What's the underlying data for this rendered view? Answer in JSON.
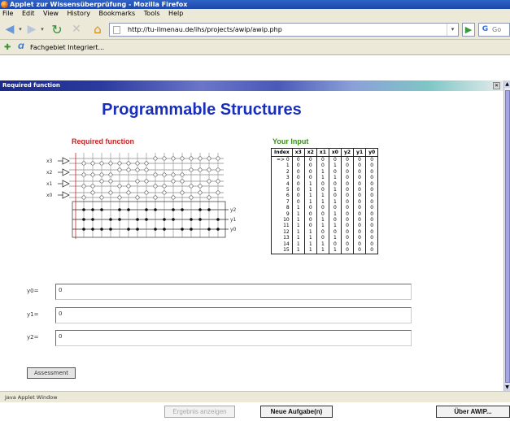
{
  "window": {
    "title": "Applet zur Wissensüberprüfung - Mozilla Firefox"
  },
  "menu": [
    "File",
    "Edit",
    "View",
    "History",
    "Bookmarks",
    "Tools",
    "Help"
  ],
  "nav": {
    "url": "http://tu-ilmenau.de/ihs/projects/awip/awip.php",
    "search_placeholder": "Go"
  },
  "tab": {
    "label": "Fachgebiet Integriert..."
  },
  "applet": {
    "header": "Required function",
    "title": "Programmable Structures",
    "required_label": "Required function",
    "input_label": "Your Input",
    "pla_inputs": [
      "x3",
      "x2",
      "x1",
      "x0"
    ],
    "pla_outputs": [
      "y2",
      "y1",
      "y0"
    ]
  },
  "table": {
    "headers": [
      "Index",
      "x3",
      "x2",
      "x1",
      "x0",
      "y2",
      "y1",
      "y0"
    ],
    "rows": [
      [
        "=> 0",
        "0",
        "0",
        "0",
        "0",
        "0",
        "0",
        "0"
      ],
      [
        "1",
        "0",
        "0",
        "0",
        "1",
        "0",
        "0",
        "0"
      ],
      [
        "2",
        "0",
        "0",
        "1",
        "0",
        "0",
        "0",
        "0"
      ],
      [
        "3",
        "0",
        "0",
        "1",
        "1",
        "0",
        "0",
        "0"
      ],
      [
        "4",
        "0",
        "1",
        "0",
        "0",
        "0",
        "0",
        "0"
      ],
      [
        "5",
        "0",
        "1",
        "0",
        "1",
        "0",
        "0",
        "0"
      ],
      [
        "6",
        "0",
        "1",
        "1",
        "0",
        "0",
        "0",
        "0"
      ],
      [
        "7",
        "0",
        "1",
        "1",
        "1",
        "0",
        "0",
        "0"
      ],
      [
        "8",
        "1",
        "0",
        "0",
        "0",
        "0",
        "0",
        "0"
      ],
      [
        "9",
        "1",
        "0",
        "0",
        "1",
        "0",
        "0",
        "0"
      ],
      [
        "10",
        "1",
        "0",
        "1",
        "0",
        "0",
        "0",
        "0"
      ],
      [
        "11",
        "1",
        "0",
        "1",
        "1",
        "0",
        "0",
        "0"
      ],
      [
        "12",
        "1",
        "1",
        "0",
        "0",
        "0",
        "0",
        "0"
      ],
      [
        "13",
        "1",
        "1",
        "0",
        "1",
        "0",
        "0",
        "0"
      ],
      [
        "14",
        "1",
        "1",
        "1",
        "0",
        "0",
        "0",
        "0"
      ],
      [
        "15",
        "1",
        "1",
        "1",
        "1",
        "0",
        "0",
        "0"
      ]
    ]
  },
  "equations": {
    "y0": {
      "label": "y0=",
      "value": "0"
    },
    "y1": {
      "label": "y1=",
      "value": "0"
    },
    "y2": {
      "label": "y2=",
      "value": "0"
    }
  },
  "assessment_button": "Assessment",
  "status_line": "Java Applet Window",
  "bottom_buttons": {
    "show": "Ergebnis anzeigen",
    "new": "Neue Aufgabe(n)",
    "about": "Über AWIP..."
  }
}
